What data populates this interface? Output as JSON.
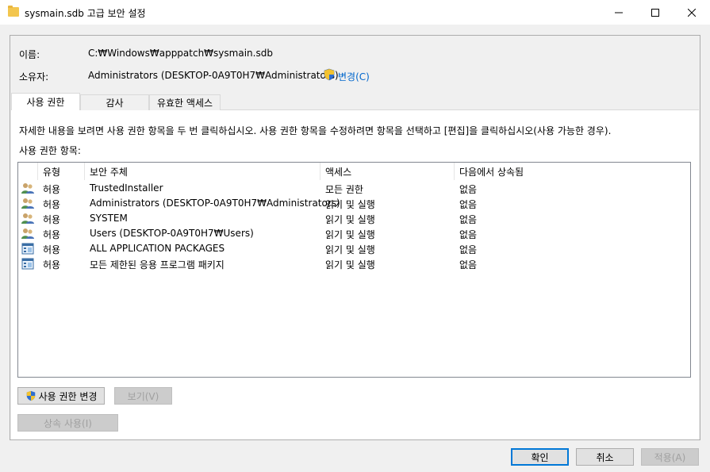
{
  "window": {
    "title": "sysmain.sdb 고급 보안 설정"
  },
  "info": {
    "name_label": "이름:",
    "name_value": "C:₩Windows₩apppatch₩sysmain.sdb",
    "owner_label": "소유자:",
    "owner_value": "Administrators (DESKTOP-0A9T0H7₩Administrators)",
    "change_link": "변경(C)"
  },
  "tabs": [
    {
      "label": "사용 권한"
    },
    {
      "label": "감사"
    },
    {
      "label": "유효한 액세스"
    }
  ],
  "description": "자세한 내용을 보려면 사용 권한 항목을 두 번 클릭하십시오. 사용 권한 항목을 수정하려면 항목을 선택하고 [편집]을 클릭하십시오(사용 가능한 경우).",
  "entries_label": "사용 권한 항목:",
  "columns": [
    "유형",
    "보안 주체",
    "액세스",
    "다음에서 상속됨"
  ],
  "rows": [
    {
      "icon": "user-group-icon",
      "type": "허용",
      "principal": "TrustedInstaller",
      "access": "모든 권한",
      "inherited": "없음"
    },
    {
      "icon": "user-group-icon",
      "type": "허용",
      "principal": "Administrators (DESKTOP-0A9T0H7₩Administrators)",
      "access": "읽기 및 실행",
      "inherited": "없음"
    },
    {
      "icon": "user-group-icon",
      "type": "허용",
      "principal": "SYSTEM",
      "access": "읽기 및 실행",
      "inherited": "없음"
    },
    {
      "icon": "user-group-icon",
      "type": "허용",
      "principal": "Users (DESKTOP-0A9T0H7₩Users)",
      "access": "읽기 및 실행",
      "inherited": "없음"
    },
    {
      "icon": "package-icon",
      "type": "허용",
      "principal": "ALL APPLICATION PACKAGES",
      "access": "읽기 및 실행",
      "inherited": "없음"
    },
    {
      "icon": "package-icon",
      "type": "허용",
      "principal": "모든 제한된 응용 프로그램 패키지",
      "access": "읽기 및 실행",
      "inherited": "없음"
    }
  ],
  "buttons": {
    "change_permissions": "사용 권한 변경",
    "view": "보기(V)",
    "inheritance": "상속 사용(I)",
    "ok": "확인",
    "cancel": "취소",
    "apply": "적용(A)"
  },
  "colors": {
    "accent": "#0078d7",
    "link": "#0066cc",
    "disabled_text": "#a0a0a0"
  }
}
